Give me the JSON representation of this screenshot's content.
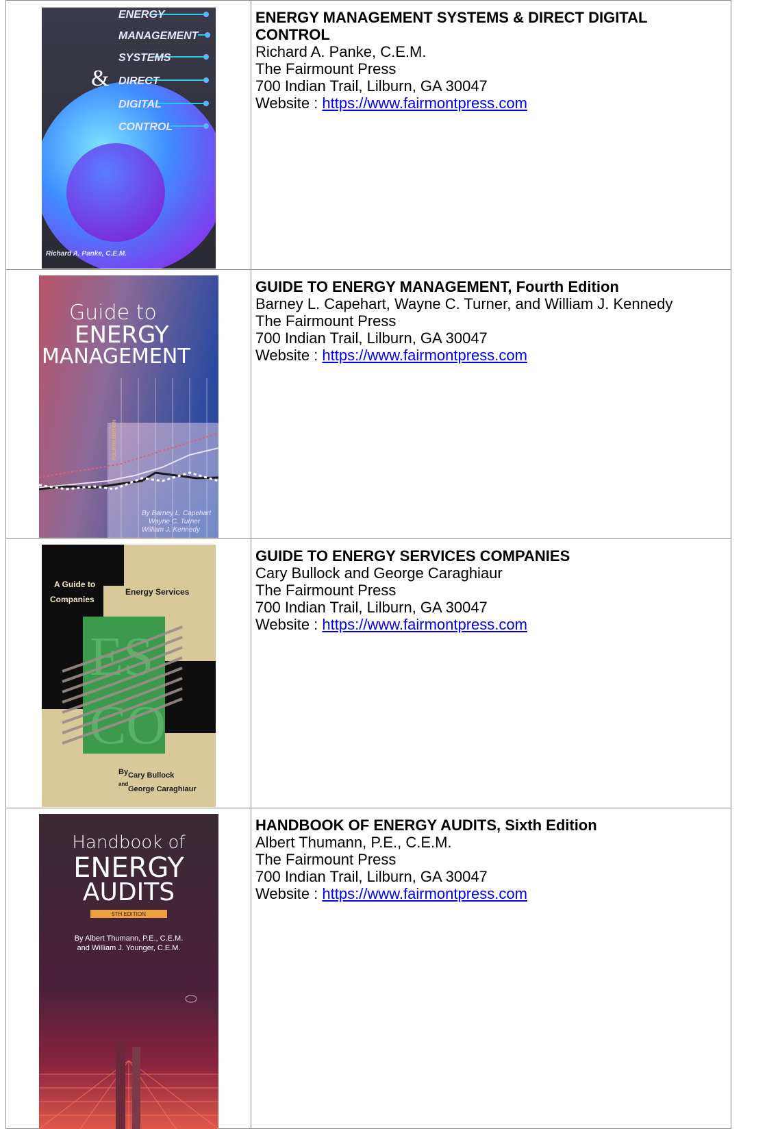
{
  "books": [
    {
      "title": "ENERGY MANAGEMENT SYSTEMS & DIRECT DIGITAL CONTROL",
      "author": "Richard A. Panke, C.E.M.",
      "publisher": "The Fairmount Press",
      "address": "700 Indian Trail, Lilburn, GA 30047",
      "website_label": "Website : ",
      "website_url": "https://www.fairmontpress.com",
      "cover": {
        "lines": [
          "ENERGY",
          "MANAGEMENT",
          "SYSTEMS",
          "DIRECT",
          "DIGITAL",
          "CONTROL"
        ],
        "ampersand": "&",
        "byline": "Richard A. Panke, C.E.M."
      }
    },
    {
      "title": "GUIDE TO ENERGY MANAGEMENT, Fourth Edition",
      "author": "Barney L. Capehart, Wayne C. Turner, and William J. Kennedy",
      "publisher": "The Fairmount Press",
      "address": "700 Indian Trail, Lilburn, GA 30047",
      "website_label": "Website : ",
      "website_url": "https://www.fairmontpress.com",
      "cover": {
        "line1": "Guide to",
        "line2": "ENERGY",
        "line3": "MANAGEMENT",
        "edition": "FOURTH EDITION",
        "byline1": "By Barney L. Capehart",
        "byline2": "Wayne C. Turner",
        "byline3": "William J. Kennedy"
      }
    },
    {
      "title": "GUIDE TO ENERGY SERVICES COMPANIES",
      "author": "Cary Bullock and George Caraghiaur",
      "publisher": "The Fairmount Press",
      "address": "700 Indian Trail, Lilburn, GA 30047",
      "website_label": "Website : ",
      "website_url": "https://www.fairmontpress.com",
      "cover": {
        "line1a": "A Guide to",
        "line1b": "Energy Services",
        "line2": "Companies",
        "big1": "ES",
        "big2": "CO",
        "by": "By",
        "byline1": "Cary Bullock",
        "and": "and",
        "byline2": "George Caraghiaur"
      }
    },
    {
      "title": "HANDBOOK OF ENERGY AUDITS, Sixth Edition",
      "author": "Albert Thumann, P.E., C.E.M.",
      "publisher": "The Fairmount Press",
      "address": "700 Indian Trail, Lilburn, GA 30047",
      "website_label": "Website : ",
      "website_url": "https://www.fairmontpress.com",
      "cover": {
        "line1": "Handbook of",
        "line2": "ENERGY",
        "line3": "AUDITS",
        "edition": "5TH EDITION",
        "byline1": "By Albert Thumann, P.E., C.E.M.",
        "byline2": "and William J. Younger, C.E.M."
      }
    }
  ]
}
